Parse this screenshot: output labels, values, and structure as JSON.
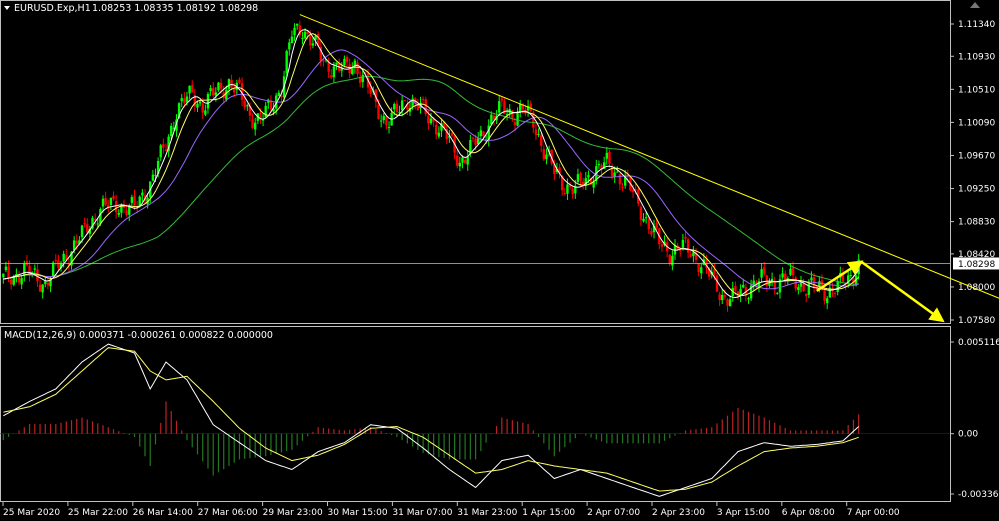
{
  "header": {
    "instrument": "EURUSD.Exp,H1",
    "ohlc": "1.08253 1.08335 1.08192 1.08298"
  },
  "macd_header": "MACD(12,26,9) 0.000371 -0.000261 0.000822 0.000000",
  "current_price_label": "1.08298",
  "colors": {
    "background": "#000000",
    "bull": "#00ff00",
    "bear": "#ff0000",
    "trendline": "#ffff00",
    "ma_fast": "#ffffff",
    "ma_slow": "#ffff66",
    "ma_medium": "#9966ff",
    "ma_long": "#33bb33",
    "hist_pos": "#bb2222",
    "hist_neg": "#227722",
    "grid_frame": "#c0c0c0"
  },
  "chart_data": [
    {
      "type": "candlestick",
      "title": "EURUSD.Exp,H1",
      "ylim": [
        1.0735,
        1.116
      ],
      "yticks": [
        "1.11340",
        "1.10930",
        "1.10510",
        "1.10090",
        "1.09670",
        "1.09250",
        "1.08830",
        "1.08420",
        "1.08000",
        "1.07580"
      ],
      "ytick_values": [
        1.1134,
        1.1093,
        1.1051,
        1.1009,
        1.0967,
        1.0925,
        1.0883,
        1.0842,
        1.08,
        1.0758
      ],
      "xticks": [
        "25 Mar 2020",
        "25 Mar 22:00",
        "26 Mar 14:00",
        "27 Mar 06:00",
        "29 Mar 23:00",
        "30 Mar 15:00",
        "31 Mar 07:00",
        "31 Mar 23:00",
        "1 Apr 15:00",
        "2 Apr 07:00",
        "2 Apr 23:00",
        "3 Apr 15:00",
        "6 Apr 08:00",
        "7 Apr 00:00"
      ],
      "current_price": 1.08298,
      "close_path": [
        [
          0,
          1.081
        ],
        [
          8,
          1.082
        ],
        [
          16,
          1.0805
        ],
        [
          24,
          1.084
        ],
        [
          30,
          1.0865
        ],
        [
          37,
          1.09
        ],
        [
          44,
          1.0905
        ],
        [
          50,
          1.0898
        ],
        [
          56,
          1.0932
        ],
        [
          62,
          1.098
        ],
        [
          66,
          1.1025
        ],
        [
          72,
          1.1045
        ],
        [
          76,
          1.103
        ],
        [
          82,
          1.105
        ],
        [
          86,
          1.106
        ],
        [
          90,
          1.1045
        ],
        [
          94,
          1.102
        ],
        [
          98,
          1.101
        ],
        [
          102,
          1.103
        ],
        [
          106,
          1.1055
        ],
        [
          110,
          1.112
        ],
        [
          114,
          1.113
        ],
        [
          118,
          1.111
        ],
        [
          122,
          1.1085
        ],
        [
          126,
          1.108
        ],
        [
          130,
          1.1075
        ],
        [
          134,
          1.1085
        ],
        [
          138,
          1.106
        ],
        [
          142,
          1.103
        ],
        [
          146,
          1.101
        ],
        [
          150,
          1.102
        ],
        [
          154,
          1.104
        ],
        [
          158,
          1.103
        ],
        [
          162,
          1.1015
        ],
        [
          166,
          1.1005
        ],
        [
          170,
          1.0985
        ],
        [
          174,
          1.096
        ],
        [
          178,
          1.0975
        ],
        [
          182,
          1.099
        ],
        [
          186,
          1.1015
        ],
        [
          190,
          1.1025
        ],
        [
          194,
          1.102
        ],
        [
          198,
          1.1025
        ],
        [
          202,
          1.101
        ],
        [
          206,
          1.0975
        ],
        [
          210,
          1.0945
        ],
        [
          214,
          1.093
        ],
        [
          218,
          1.0925
        ],
        [
          222,
          1.0935
        ],
        [
          226,
          1.095
        ],
        [
          230,
          1.0955
        ],
        [
          234,
          1.0945
        ],
        [
          238,
          1.093
        ],
        [
          242,
          1.0905
        ],
        [
          246,
          1.088
        ],
        [
          250,
          1.0855
        ],
        [
          254,
          1.0845
        ],
        [
          258,
          1.085
        ],
        [
          262,
          1.0845
        ],
        [
          266,
          1.083
        ],
        [
          270,
          1.081
        ],
        [
          274,
          1.079
        ],
        [
          278,
          1.0785
        ],
        [
          282,
          1.0795
        ],
        [
          286,
          1.0805
        ],
        [
          290,
          1.0808
        ],
        [
          294,
          1.0806
        ],
        [
          298,
          1.081
        ],
        [
          302,
          1.0808
        ],
        [
          306,
          1.08
        ],
        [
          310,
          1.0798
        ],
        [
          314,
          1.0795
        ],
        [
          318,
          1.08
        ],
        [
          322,
          1.081
        ],
        [
          326,
          1.0829
        ]
      ],
      "series": [
        {
          "name": "Trendline",
          "points": [
            [
              113,
              1.1146
            ],
            [
              380,
              1.0785
            ]
          ]
        },
        {
          "name": "Arrow up",
          "points": [
            [
              310,
              1.0795
            ],
            [
              327,
              1.0832
            ]
          ]
        },
        {
          "name": "Arrow down",
          "points": [
            [
              327,
              1.0832
            ],
            [
              358,
              1.0757
            ]
          ]
        }
      ]
    },
    {
      "type": "line",
      "title": "MACD(12,26,9)",
      "ylim": [
        -0.00365,
        0.00511
      ],
      "yticks": [
        "0.005116",
        "0.00",
        "-0.003365"
      ],
      "ytick_values": [
        0.005116,
        0.0,
        -0.003365
      ],
      "macd_path": [
        [
          0,
          0.001
        ],
        [
          10,
          0.0018
        ],
        [
          20,
          0.0025
        ],
        [
          30,
          0.004
        ],
        [
          40,
          0.005
        ],
        [
          50,
          0.0045
        ],
        [
          56,
          0.0025
        ],
        [
          62,
          0.004
        ],
        [
          70,
          0.003
        ],
        [
          80,
          0.0005
        ],
        [
          90,
          -0.0005
        ],
        [
          100,
          -0.0015
        ],
        [
          110,
          -0.002
        ],
        [
          120,
          -0.001
        ],
        [
          130,
          -0.0005
        ],
        [
          140,
          0.0005
        ],
        [
          150,
          0.0003
        ],
        [
          160,
          -0.0008
        ],
        [
          170,
          -0.002
        ],
        [
          180,
          -0.003
        ],
        [
          190,
          -0.0015
        ],
        [
          200,
          -0.0012
        ],
        [
          210,
          -0.0025
        ],
        [
          220,
          -0.002
        ],
        [
          230,
          -0.0025
        ],
        [
          240,
          -0.003
        ],
        [
          250,
          -0.0035
        ],
        [
          260,
          -0.003
        ],
        [
          270,
          -0.0025
        ],
        [
          280,
          -0.001
        ],
        [
          290,
          -0.0005
        ],
        [
          300,
          -0.0007
        ],
        [
          310,
          -0.0006
        ],
        [
          320,
          -0.0004
        ],
        [
          326,
          0.0004
        ]
      ],
      "signal_path": [
        [
          0,
          0.0012
        ],
        [
          10,
          0.0015
        ],
        [
          20,
          0.0022
        ],
        [
          30,
          0.0035
        ],
        [
          40,
          0.0048
        ],
        [
          50,
          0.0046
        ],
        [
          56,
          0.0035
        ],
        [
          62,
          0.003
        ],
        [
          70,
          0.0032
        ],
        [
          80,
          0.0018
        ],
        [
          90,
          0.0003
        ],
        [
          100,
          -0.0008
        ],
        [
          110,
          -0.0015
        ],
        [
          120,
          -0.0012
        ],
        [
          130,
          -0.0006
        ],
        [
          140,
          0.0003
        ],
        [
          150,
          0.0004
        ],
        [
          160,
          -0.0002
        ],
        [
          170,
          -0.0012
        ],
        [
          180,
          -0.0022
        ],
        [
          190,
          -0.002
        ],
        [
          200,
          -0.0015
        ],
        [
          210,
          -0.0018
        ],
        [
          220,
          -0.002
        ],
        [
          230,
          -0.0022
        ],
        [
          240,
          -0.0027
        ],
        [
          250,
          -0.0032
        ],
        [
          260,
          -0.0031
        ],
        [
          270,
          -0.0027
        ],
        [
          280,
          -0.0018
        ],
        [
          290,
          -0.001
        ],
        [
          300,
          -0.0008
        ],
        [
          310,
          -0.0007
        ],
        [
          320,
          -0.0005
        ],
        [
          326,
          -0.0002
        ]
      ]
    }
  ]
}
